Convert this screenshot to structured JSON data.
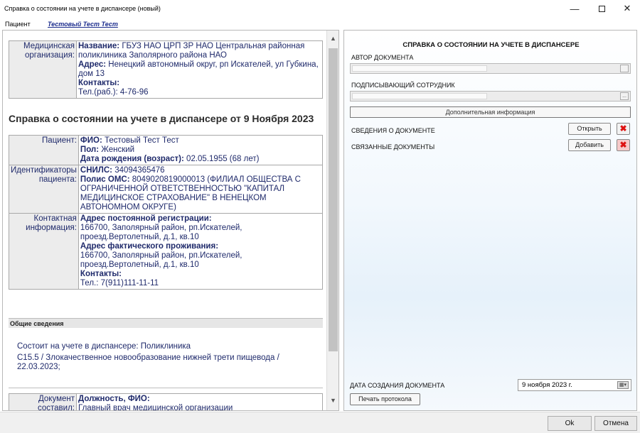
{
  "window": {
    "title": "Справка о состоянии на учете в диспансере (новый)",
    "minimize": "—",
    "close": "✕"
  },
  "patient_bar": {
    "label": "Пациент",
    "name_link": "Тестовый Тест Тест"
  },
  "document": {
    "org": {
      "key": "Медицинская организация:",
      "name_label": "Название:",
      "name_value": " ГБУЗ НАО ЦРП ЗР НАО Центральная районная поликлиника Заполярного района НАО",
      "address_label": "Адрес:",
      "address_value": " Ненецкий автономный округ, рп Искателей, ул Губкина, дом 13",
      "contacts_label": "Контакты:",
      "contacts_value": "Тел.(раб.): 4-76-96"
    },
    "heading": "Справка о состоянии на учете в диспансере от 9 Ноября 2023",
    "patient": {
      "key": "Пациент:",
      "fio_label": "ФИО:",
      "fio_value": " Тестовый Тест Тест",
      "sex_label": "Пол:",
      "sex_value": " Женский",
      "dob_label": "Дата рождения (возраст):",
      "dob_value": " 02.05.1955 (68 лет)"
    },
    "ids": {
      "key": "Идентификаторы пациента:",
      "snils_label": "СНИЛС:",
      "snils_value": " 34094365476",
      "oms_label": "Полис ОМС:",
      "oms_value": " 8049020819000013 (ФИЛИАЛ ОБЩЕСТВА С ОГРАНИЧЕННОЙ ОТВЕТСТВЕННОСТЬЮ \"КАПИТАЛ МЕДИЦИНСКОЕ СТРАХОВАНИЕ\" В НЕНЕЦКОМ АВТОНОМНОМ ОКРУГЕ)"
    },
    "contact": {
      "key": "Контактная информация:",
      "reg_label": "Адрес постоянной регистрации:",
      "reg_value": "166700, Заполярный район, рп.Искателей, проезд.Вертолетный, д.1, кв.10",
      "fact_label": "Адрес фактического проживания:",
      "fact_value": "166700, Заполярный район, рп.Искателей, проезд.Вертолетный, д.1, кв.10",
      "contacts_label": "Контакты:",
      "contacts_value": "Тел.: 7(911)111-11-11"
    },
    "general_header": "Общие сведения",
    "general_line1": "Состоит на учете в диспансере: Поликлиника",
    "general_line2": "C15.5 / Злокачественное новообразование нижней трети пищевода / 22.03.2023;",
    "author_table": {
      "key": "Документ составил:",
      "position_label": "Должность, ФИО:",
      "position_value": "Главный врач медицинской организации"
    }
  },
  "form": {
    "title": "СПРАВКА О СОСТОЯНИИ НА УЧЕТЕ В ДИСПАНСЕРЕ",
    "author_label": "АВТОР ДОКУМЕНТА",
    "signer_label": "ПОДПИСЫВАЮЩИЙ СОТРУДНИК",
    "signer_button": "...",
    "extra_info_button": "Дополнительная информация",
    "doc_info_label": "СВЕДЕНИЯ О ДОКУМЕНТЕ",
    "open_button": "Открыть",
    "related_label": "СВЯЗАННЫЕ ДОКУМЕНТЫ",
    "add_button": "Добавить",
    "created_label": "ДАТА СОЗДАНИЯ ДОКУМЕНТА",
    "created_value": "9  ноября  2023 г.",
    "print_button": "Печать протокола"
  },
  "footer": {
    "ok_button": "Ok",
    "cancel_button": "Отмена"
  }
}
